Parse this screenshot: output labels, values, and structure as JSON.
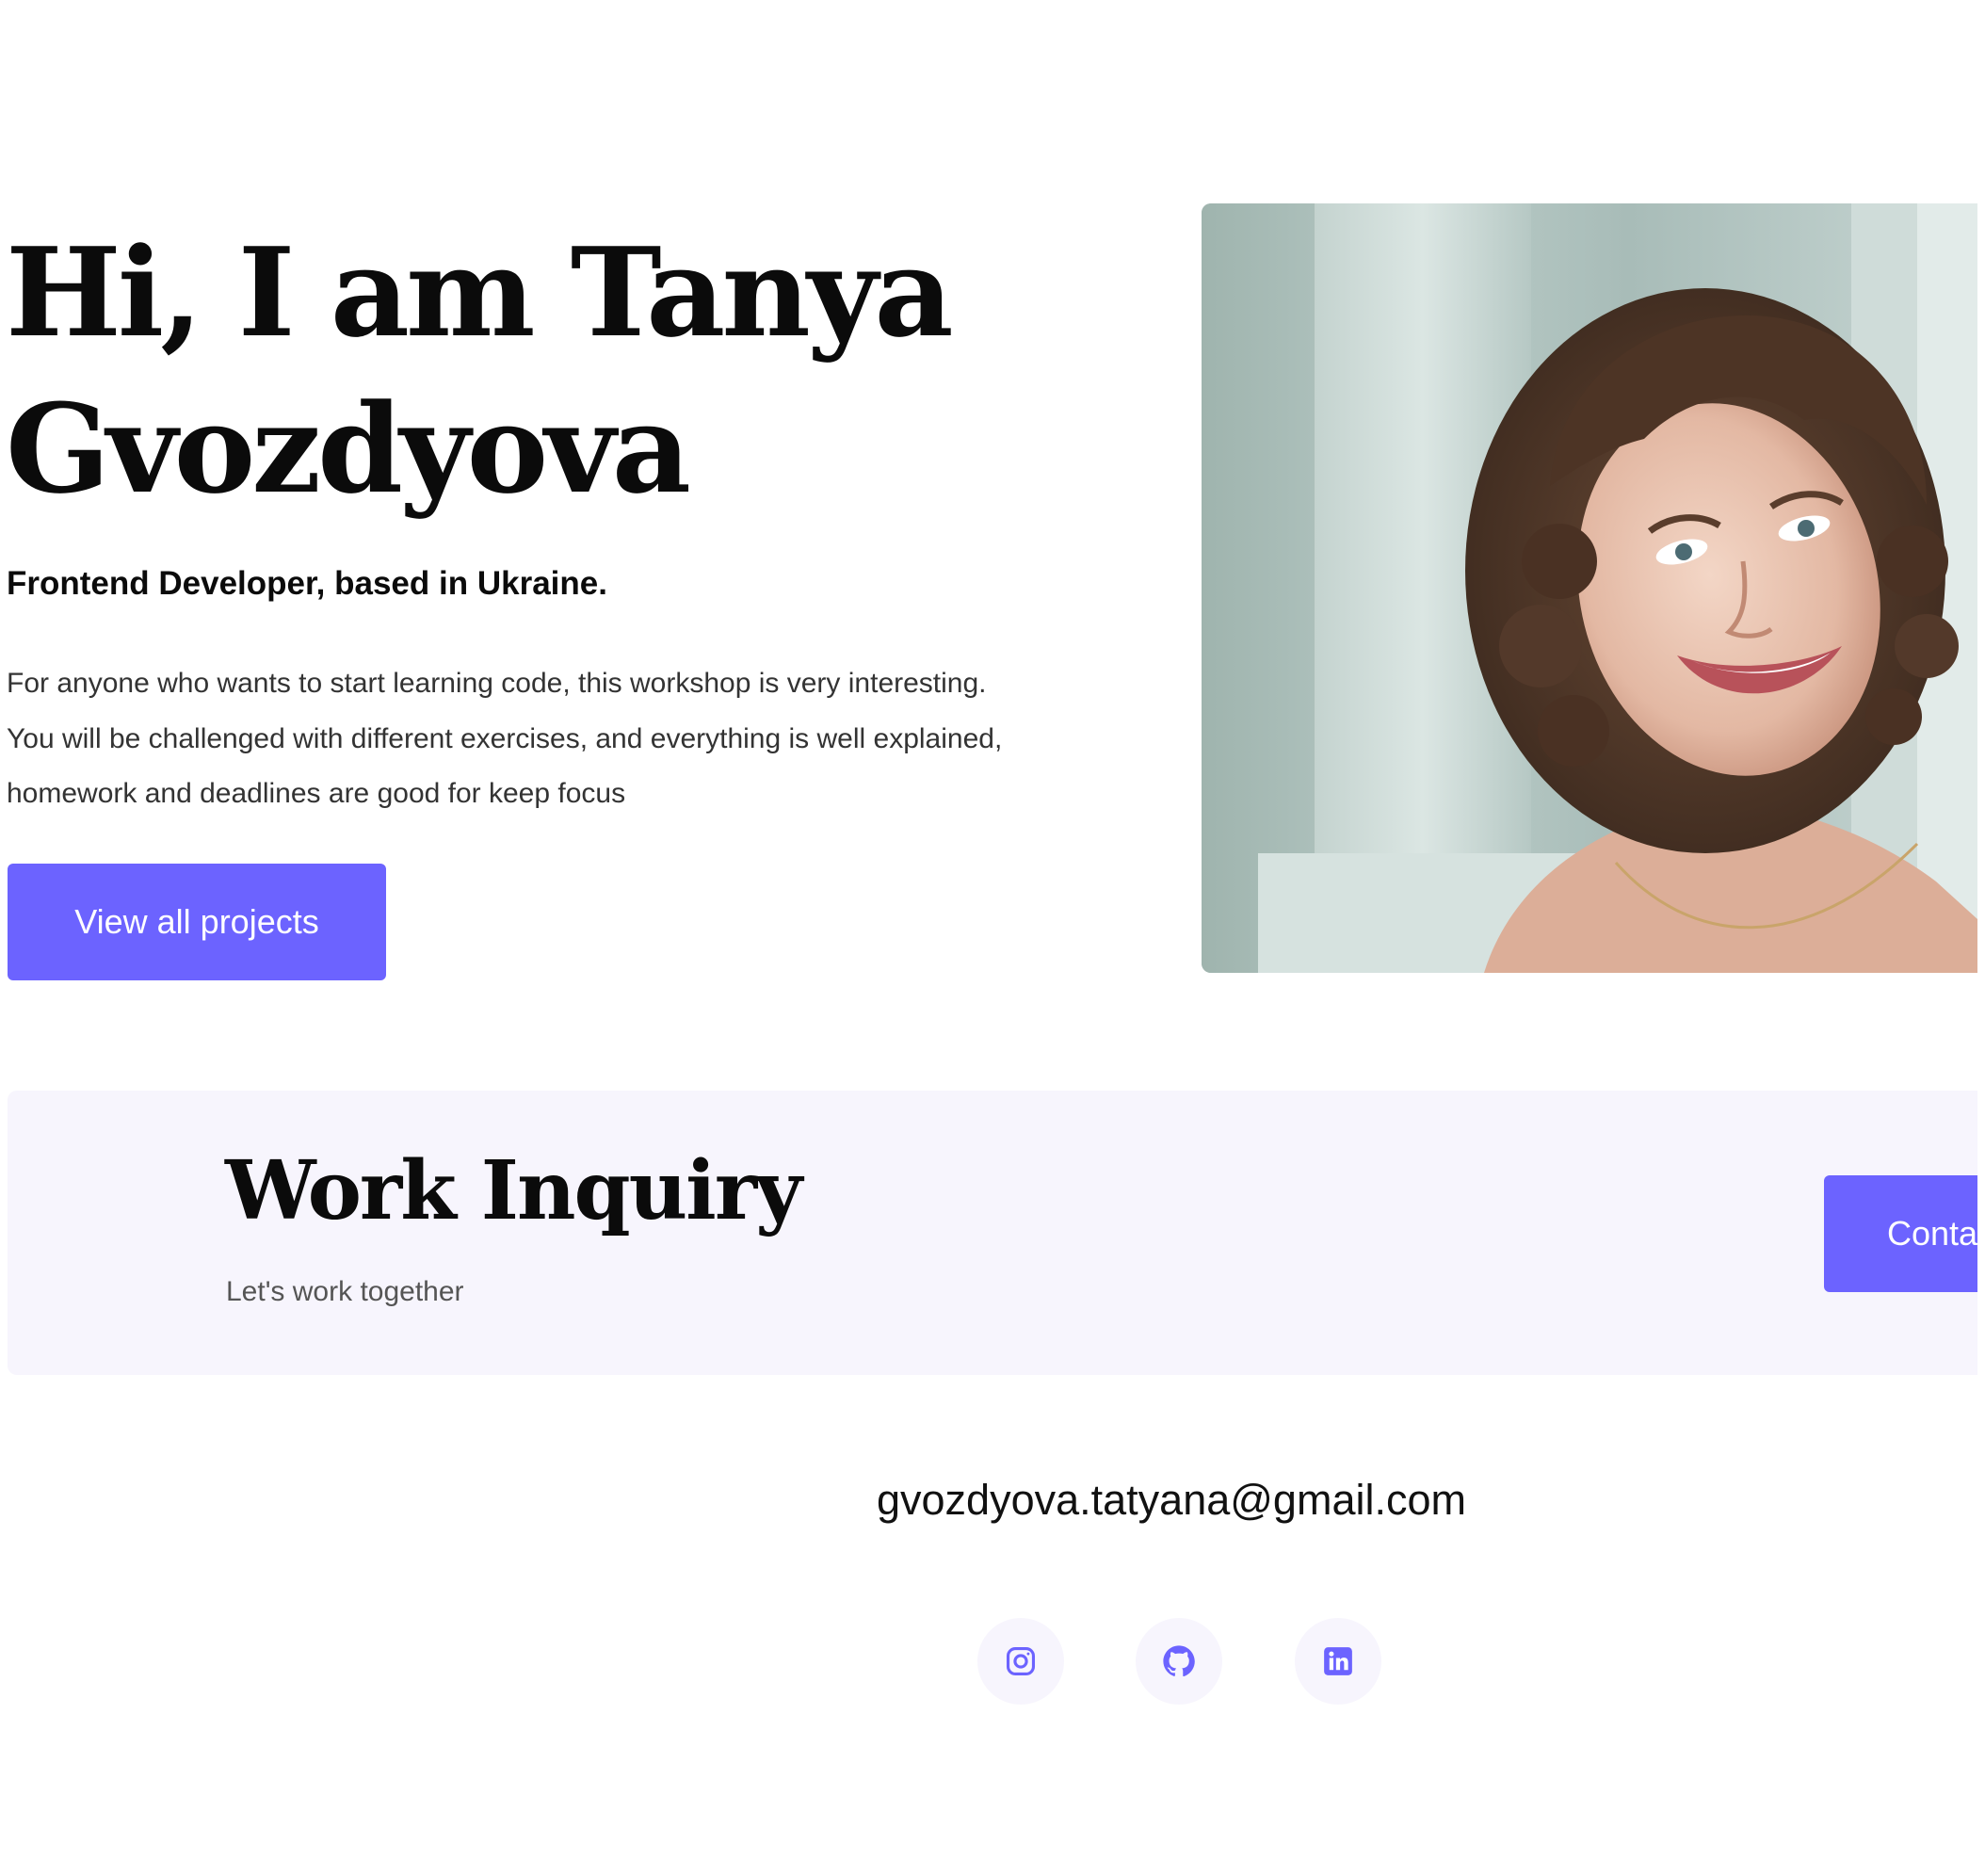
{
  "hero": {
    "title": "Hi, I am Tanya Gvozdyova",
    "subtitle": "Frontend Developer, based in Ukraine.",
    "description": "For anyone who wants to start learning code, this workshop is very interesting. You will be challenged with different exercises, and everything is well explained, homework and deadlines are good for keep focus",
    "cta_label": "View all projects"
  },
  "work_inquiry": {
    "title": "Work Inquiry",
    "subtitle": "Let's work together",
    "contact_label": "Contact"
  },
  "footer": {
    "email": "gvozdyova.tatyana@gmail.com",
    "socials": [
      {
        "icon": "instagram-icon"
      },
      {
        "icon": "github-icon"
      },
      {
        "icon": "linkedin-icon"
      }
    ]
  },
  "colors": {
    "accent": "#6c63ff",
    "panel_background": "#f7f5fd",
    "heading": "#0b0b0b"
  }
}
